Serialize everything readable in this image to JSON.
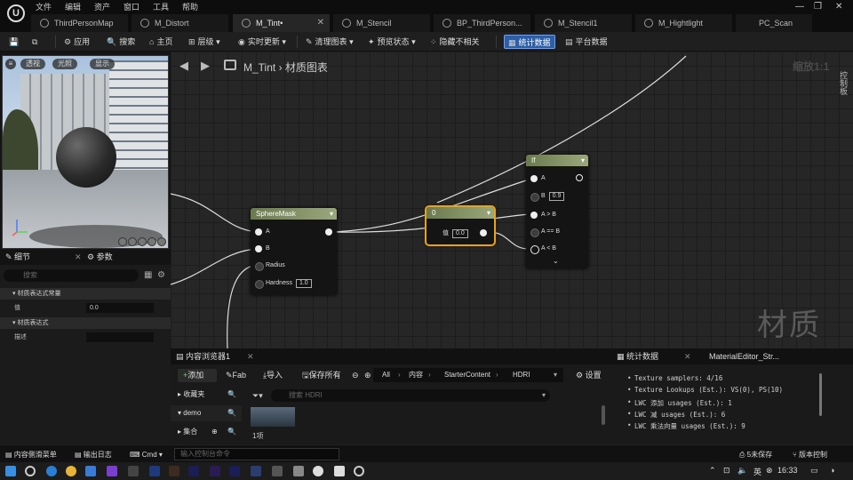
{
  "menu": [
    "文件",
    "编辑",
    "资产",
    "窗口",
    "工具",
    "帮助"
  ],
  "tabs": [
    {
      "label": "ThirdPersonMap",
      "active": false,
      "modified": false
    },
    {
      "label": "M_Distort",
      "active": false,
      "modified": false
    },
    {
      "label": "M_Tint•",
      "active": true,
      "modified": true
    },
    {
      "label": "M_Stencil",
      "active": false,
      "modified": false
    },
    {
      "label": "BP_ThirdPerson...",
      "active": false,
      "modified": true
    },
    {
      "label": "M_Stencil1",
      "active": false,
      "modified": false
    },
    {
      "label": "M_Hightlight",
      "active": false,
      "modified": false
    },
    {
      "label": "PC_Scan",
      "active": false,
      "modified": false
    }
  ],
  "toolbar": {
    "apply": "应用",
    "search": "搜索",
    "home": "主页",
    "hierarchy": "层级",
    "live_update": "实时更新",
    "clean_graph": "清理图表",
    "preview_state": "预览状态",
    "hide_unrelated": "隐藏不相关",
    "stats": "统计数据",
    "platform_stats": "平台数据"
  },
  "viewport": {
    "perspective": "透视",
    "lit": "光照",
    "show": "显示"
  },
  "details": {
    "tab_details": "细节",
    "tab_params": "参数",
    "search_placeholder": "搜索",
    "section_constant": "材质表达式常量",
    "value_label": "值",
    "value": "0.0",
    "section_expression": "材质表达式",
    "desc_label": "描述",
    "desc_value": ""
  },
  "graph": {
    "breadcrumb": "M_Tint",
    "breadcrumb_sub": "材质图表",
    "zoom": "缩放1:1",
    "watermark": "材质",
    "side_tab": "控制板",
    "sphere_mask": {
      "title": "SphereMask",
      "pin_a": "A",
      "pin_b": "B",
      "pin_radius": "Radius",
      "pin_hardness": "Hardness",
      "hardness_value": "1.0"
    },
    "constant": {
      "title": "0",
      "value_label": "值",
      "value": "0.0"
    },
    "if_node": {
      "title": "If",
      "pin_a": "A",
      "pin_b": "B",
      "b_value": "0.9",
      "pin_gt": "A > B",
      "pin_eq": "A == B",
      "pin_lt": "A < B"
    }
  },
  "content_browser": {
    "tab": "内容浏览器1",
    "add": "添加",
    "fab": "Fab",
    "import": "导入",
    "save_all": "保存所有",
    "path": [
      "All",
      "内容",
      "StarterContent",
      "HDRI"
    ],
    "settings": "设置",
    "favorites": "收藏夹",
    "demo": "demo",
    "collections": "集合",
    "search_placeholder": "搜索 HDRI",
    "item_count": "1项"
  },
  "stats": {
    "tab": "统计数据",
    "tab2": "MaterialEditor_Str...",
    "lines": [
      "Texture samplers: 4/16",
      "Texture Lookups (Est.): VS(0), PS(10)",
      "LWC 添加 usages (Est.): 1",
      "LWC 减 usages (Est.): 6",
      "LWC 乘法向量 usages (Est.): 9"
    ]
  },
  "statusbar": {
    "content_drawer": "内容侧滑菜单",
    "output_log": "输出日志",
    "cmd": "Cmd",
    "cmd_placeholder": "输入控制台命令",
    "unsaved": "5未保存",
    "source_control": "版本控制"
  },
  "taskbar": {
    "lang": "英",
    "time": "16:33"
  },
  "colors": {
    "node_header": "#8b9a6a",
    "selected_outline": "#e8a317",
    "stats_active": "#2d5fa8"
  }
}
